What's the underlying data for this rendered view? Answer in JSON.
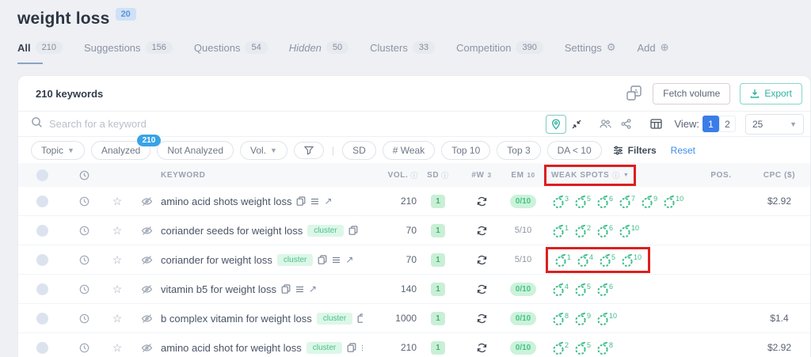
{
  "page": {
    "title": "weight loss",
    "title_badge": "20"
  },
  "tabs": [
    {
      "label": "All",
      "badge": "210"
    },
    {
      "label": "Suggestions",
      "badge": "156"
    },
    {
      "label": "Questions",
      "badge": "54"
    },
    {
      "label": "Hidden",
      "badge": "50"
    },
    {
      "label": "Clusters",
      "badge": "33"
    },
    {
      "label": "Competition",
      "badge": "390"
    },
    {
      "label": "Settings"
    },
    {
      "label": "Add"
    }
  ],
  "toolbar": {
    "count_label": "210 keywords",
    "fetch_volume_label": "Fetch volume",
    "export_label": "Export"
  },
  "search": {
    "placeholder": "Search for a keyword"
  },
  "view": {
    "label": "View:",
    "option1": "1",
    "option2": "2",
    "page_size": "25"
  },
  "filters": {
    "topic": "Topic",
    "analyzed": "Analyzed",
    "analyzed_badge": "210",
    "not_analyzed": "Not Analyzed",
    "vol": "Vol.",
    "sd": "SD",
    "weak": "# Weak",
    "top10": "Top 10",
    "top3": "Top 3",
    "da": "DA < 10",
    "filters": "Filters",
    "reset": "Reset"
  },
  "table": {
    "columns": {
      "keyword": "KEYWORD",
      "vol": "VOL.",
      "sd": "SD",
      "w": "#W",
      "w_sup": "3",
      "em": "EM",
      "em_sup": "10",
      "weak_spots": "WEAK SPOTS",
      "pos": "POS.",
      "cpc": "CPC ($)"
    },
    "cluster_badge_label": "cluster",
    "rows": [
      {
        "keyword": "amino acid shots weight loss",
        "cluster": false,
        "vol": "210",
        "sd": "1",
        "em": "0/10",
        "em_badge": true,
        "fruits": [
          3,
          5,
          6,
          7,
          9,
          10
        ],
        "pos": "",
        "cpc": "$2.92",
        "highlight": false
      },
      {
        "keyword": "coriander seeds for weight loss",
        "cluster": true,
        "vol": "70",
        "sd": "1",
        "em": "5/10",
        "em_badge": false,
        "fruits": [
          1,
          2,
          6,
          10
        ],
        "pos": "",
        "cpc": "",
        "highlight": false
      },
      {
        "keyword": "coriander for weight loss",
        "cluster": true,
        "vol": "70",
        "sd": "1",
        "em": "5/10",
        "em_badge": false,
        "fruits": [
          1,
          4,
          5,
          10
        ],
        "pos": "",
        "cpc": "",
        "highlight": true
      },
      {
        "keyword": "vitamin b5 for weight loss",
        "cluster": false,
        "vol": "140",
        "sd": "1",
        "em": "0/10",
        "em_badge": true,
        "fruits": [
          4,
          5,
          6
        ],
        "pos": "",
        "cpc": "",
        "highlight": false
      },
      {
        "keyword": "b complex vitamin for weight loss",
        "cluster": true,
        "vol": "1000",
        "sd": "1",
        "em": "0/10",
        "em_badge": true,
        "fruits": [
          8,
          9,
          10
        ],
        "pos": "",
        "cpc": "$1.4",
        "highlight": false
      },
      {
        "keyword": "amino acid shot for weight loss",
        "cluster": true,
        "vol": "210",
        "sd": "1",
        "em": "0/10",
        "em_badge": true,
        "fruits": [
          2,
          5,
          8
        ],
        "pos": "",
        "cpc": "$2.92",
        "highlight": false
      }
    ]
  },
  "colors": {
    "accent_teal": "#2fb3a0",
    "accent_blue": "#3b7de8",
    "green": "#3dbd8a",
    "annotation_red": "#dc1f1f"
  }
}
